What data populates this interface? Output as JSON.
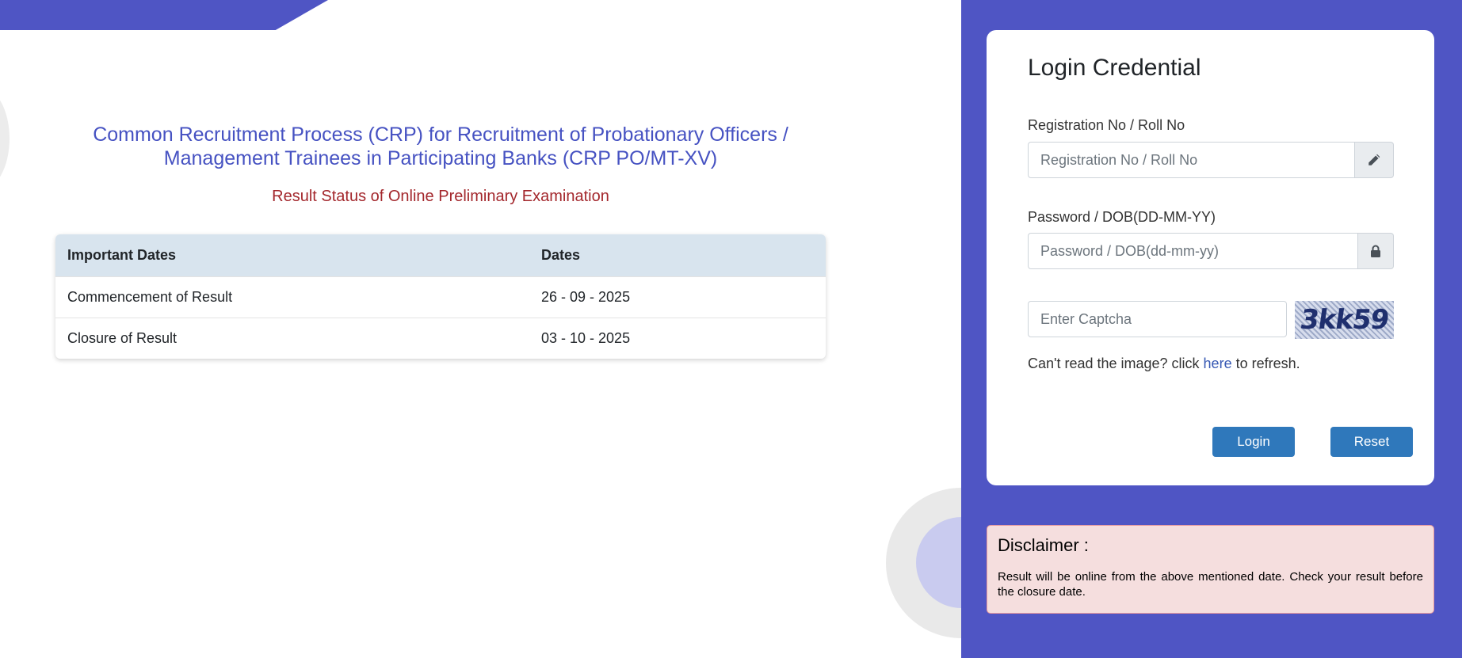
{
  "header": {
    "title": "Common Recruitment Process (CRP) for Recruitment of Probationary Officers / Management Trainees in Participating Banks (CRP PO/MT-XV)",
    "subtitle": "Result Status of Online Preliminary Examination"
  },
  "dates_table": {
    "headers": [
      "Important Dates",
      "Dates"
    ],
    "rows": [
      {
        "event": "Commencement of Result",
        "date": "26 - 09 - 2025"
      },
      {
        "event": "Closure of Result",
        "date": "03 - 10 - 2025"
      }
    ]
  },
  "login": {
    "title": "Login Credential",
    "registration_label": "Registration No / Roll No",
    "registration_placeholder": "Registration No / Roll No",
    "password_label": "Password / DOB(DD-MM-YY)",
    "password_placeholder": "Password / DOB(dd-mm-yy)",
    "captcha_placeholder": "Enter Captcha",
    "captcha_text": "3kk59",
    "refresh_prefix": "Can't read the image? click ",
    "refresh_link": "here",
    "refresh_suffix": " to refresh.",
    "login_button": "Login",
    "reset_button": "Reset",
    "icons": {
      "registration": "pencil-icon",
      "password": "lock-icon"
    }
  },
  "disclaimer": {
    "title": "Disclaimer :",
    "text": "Result will be online from the above mentioned date. Check your result before the closure date."
  },
  "colors": {
    "primary": "#4f55c4",
    "title": "#4652c2",
    "subtitle": "#a3272c",
    "button": "#2f78bb",
    "disclaimer_bg": "#f5dede"
  }
}
